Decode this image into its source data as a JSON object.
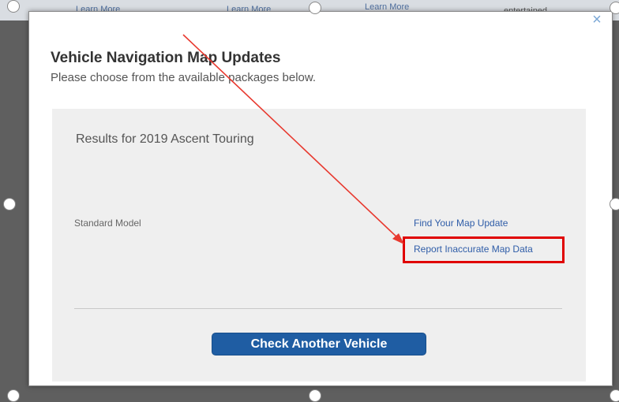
{
  "background_page": {
    "link_texts": [
      "Learn More",
      "Learn More",
      "Learn More"
    ],
    "text_fragment": "entertained"
  },
  "modal": {
    "close_icon": "close-icon",
    "title": "Vehicle Navigation Map Updates",
    "subtitle": "Please choose from the available packages below.",
    "results_heading": "Results for 2019 Ascent Touring",
    "rows": [
      {
        "model": "Standard Model",
        "links": [
          "Find Your Map Update",
          "Report Inaccurate Map Data"
        ]
      }
    ],
    "check_another_button": "Check Another Vehicle"
  },
  "annotation": {
    "arrow_color": "#e8392f",
    "highlight_color": "#e00000"
  },
  "colors": {
    "link": "#2f5da8",
    "button": "#1f5da3",
    "panel": "#efefef"
  }
}
